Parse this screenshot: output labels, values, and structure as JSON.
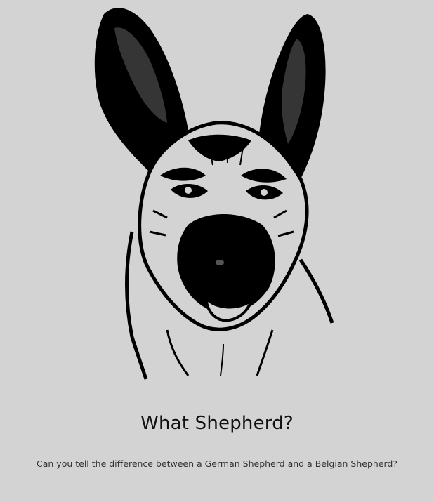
{
  "hero": {
    "illustration_icon": "dog-head-illustration-icon"
  },
  "content": {
    "title": "What Shepherd?",
    "subtitle": "Can you tell the difference between a German Shepherd and a Belgian Shepherd?"
  },
  "colors": {
    "background": "#d3d3d3",
    "ink": "#000000",
    "text": "#111111"
  }
}
